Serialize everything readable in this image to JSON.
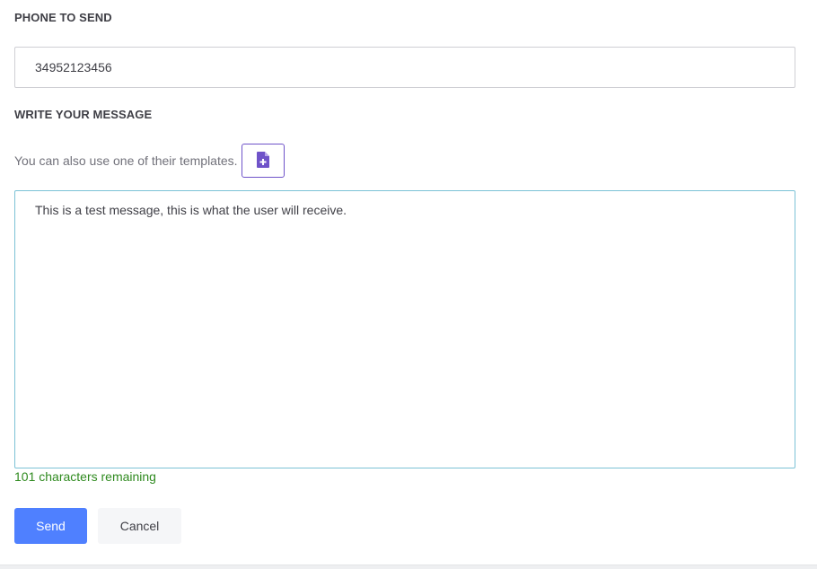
{
  "phone_section": {
    "label": "PHONE TO SEND",
    "value": "34952123456"
  },
  "message_section": {
    "label": "WRITE YOUR MESSAGE",
    "templates_hint": "You can also use one of their templates.",
    "template_button_icon": "file-plus-icon",
    "message_value": "This is a test message, this is what the user will receive.",
    "chars_remaining": "101 characters remaining"
  },
  "actions": {
    "send_label": "Send",
    "cancel_label": "Cancel"
  },
  "colors": {
    "accent_purple": "#6f53c9",
    "send_blue": "#4f80ff",
    "focus_border": "#7cc2d6",
    "success_green": "#2f8a1f"
  }
}
